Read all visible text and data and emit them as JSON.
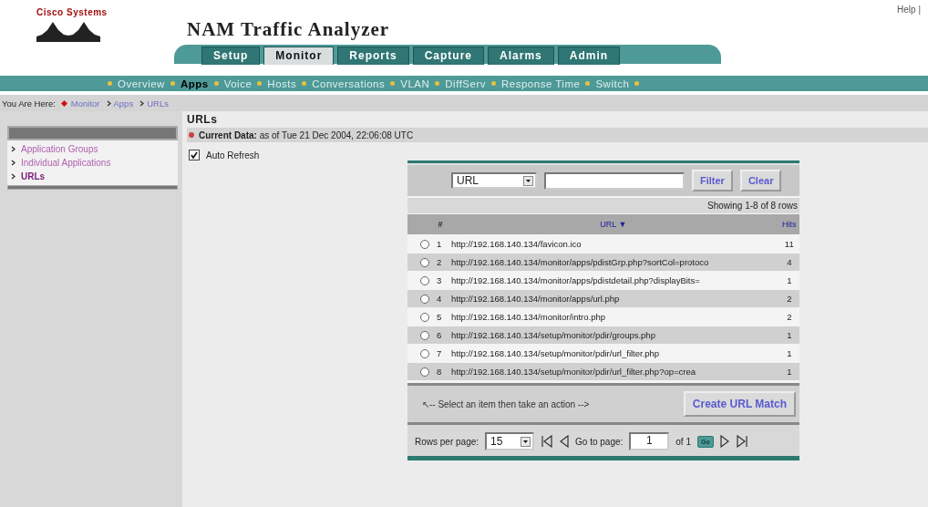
{
  "header": {
    "logo_text": "Cisco Systems",
    "title": "NAM Traffic Analyzer",
    "help_link": "Help |"
  },
  "tabs": [
    {
      "label": "Setup",
      "selected": false
    },
    {
      "label": "Monitor",
      "selected": true
    },
    {
      "label": "Reports",
      "selected": false
    },
    {
      "label": "Capture",
      "selected": false
    },
    {
      "label": "Alarms",
      "selected": false
    },
    {
      "label": "Admin",
      "selected": false
    }
  ],
  "subnav": [
    {
      "label": "Overview",
      "selected": false
    },
    {
      "label": "Apps",
      "selected": true
    },
    {
      "label": "Voice",
      "selected": false
    },
    {
      "label": "Hosts",
      "selected": false
    },
    {
      "label": "Conversations",
      "selected": false
    },
    {
      "label": "VLAN",
      "selected": false
    },
    {
      "label": "DiffServ",
      "selected": false
    },
    {
      "label": "Response Time",
      "selected": false
    },
    {
      "label": "Switch",
      "selected": false
    }
  ],
  "breadcrumb": {
    "label": "You Are Here:",
    "items": [
      "Monitor",
      "Apps",
      "URLs"
    ]
  },
  "sidebar": {
    "items": [
      {
        "label": "Application Groups",
        "selected": false
      },
      {
        "label": "Individual Applications",
        "selected": false
      },
      {
        "label": "URLs",
        "selected": true
      }
    ]
  },
  "page_title": "URLs",
  "current_data": {
    "label": "Current Data:",
    "value": "as of Tue 21 Dec 2004, 22:06:08 UTC"
  },
  "auto_refresh": {
    "label": "Auto Refresh",
    "checked": true
  },
  "filter": {
    "field": "URL",
    "filter_button": "Filter",
    "clear_button": "Clear"
  },
  "showing": "Showing 1-8 of 8 rows",
  "table": {
    "columns": [
      "#",
      "URL ▼",
      "Hits"
    ],
    "rows": [
      {
        "index": "1",
        "url": "http://192.168.140.134/favicon.ico",
        "hits": "11",
        "selected": false
      },
      {
        "index": "2",
        "url": "http://192.168.140.134/monitor/apps/pdistGrp.php?sortCol=protoco",
        "hits": "4",
        "selected": false
      },
      {
        "index": "3",
        "url": "http://192.168.140.134/monitor/apps/pdistdetail.php?displayBits=",
        "hits": "1",
        "selected": false
      },
      {
        "index": "4",
        "url": "http://192.168.140.134/monitor/apps/url.php",
        "hits": "2",
        "selected": false
      },
      {
        "index": "5",
        "url": "http://192.168.140.134/monitor/intro.php",
        "hits": "2",
        "selected": false
      },
      {
        "index": "6",
        "url": "http://192.168.140.134/setup/monitor/pdir/groups.php",
        "hits": "1",
        "selected": false
      },
      {
        "index": "7",
        "url": "http://192.168.140.134/setup/monitor/pdir/url_filter.php",
        "hits": "1",
        "selected": false
      },
      {
        "index": "8",
        "url": "http://192.168.140.134/setup/monitor/pdir/url_filter.php?op=crea",
        "hits": "1",
        "selected": false
      }
    ]
  },
  "action": {
    "hint": "↖-- Select an item then take an action -->",
    "button": "Create URL Match"
  },
  "pagination": {
    "rows_label": "Rows per page:",
    "rows_value": "15",
    "goto_label": "Go to page:",
    "page_value": "1",
    "of_label": "of 1",
    "go_button": "Go"
  }
}
